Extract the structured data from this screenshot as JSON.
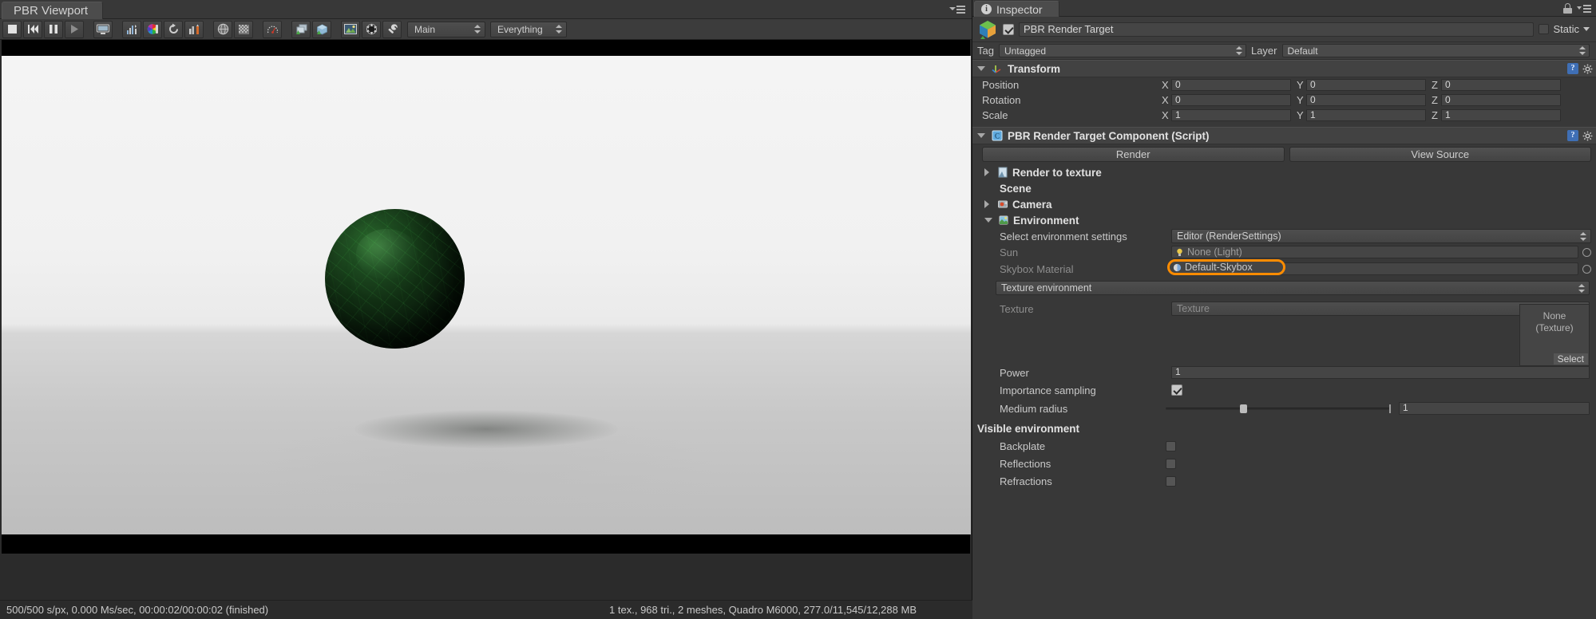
{
  "viewport": {
    "tab_label": "PBR Viewport",
    "toolbar": {
      "buttons": [
        {
          "name": "stop-button",
          "icon": "stop-icon"
        },
        {
          "name": "rewind-button",
          "icon": "rewind-icon"
        },
        {
          "name": "pause-button",
          "icon": "pause-icon"
        },
        {
          "name": "play-button",
          "icon": "play-icon"
        },
        {
          "name": "screen-button",
          "icon": "monitor-icon"
        },
        {
          "name": "histogram-button",
          "icon": "histogram-icon"
        },
        {
          "name": "color-wheel-button",
          "icon": "color-wheel-icon"
        },
        {
          "name": "refresh-button",
          "icon": "refresh-icon"
        },
        {
          "name": "levels-button",
          "icon": "levels-icon"
        },
        {
          "name": "sphere-button",
          "icon": "sphere-icon"
        },
        {
          "name": "checker-button",
          "icon": "checker-icon"
        },
        {
          "name": "gauge-button",
          "icon": "gauge-icon"
        },
        {
          "name": "layers-button",
          "icon": "layers-icon"
        },
        {
          "name": "cube-button",
          "icon": "cube-icon"
        },
        {
          "name": "image-button",
          "icon": "image-icon"
        },
        {
          "name": "aperture-button",
          "icon": "aperture-icon"
        },
        {
          "name": "wrench-button",
          "icon": "wrench-icon"
        }
      ],
      "camera_select": "Main",
      "layer_select": "Everything"
    },
    "status": {
      "left": "500/500 s/px, 0.000 Ms/sec, 00:00:02/00:00:02 (finished)",
      "right": "1 tex., 968 tri., 2 meshes, Quadro M6000, 277.0/11,545/12,288 MB"
    }
  },
  "inspector": {
    "tab_label": "Inspector",
    "object": {
      "name_value": "PBR Render Target",
      "enabled": true,
      "static_label": "Static",
      "tag_label": "Tag",
      "tag_value": "Untagged",
      "layer_label": "Layer",
      "layer_value": "Default"
    },
    "transform": {
      "title": "Transform",
      "rows": [
        {
          "label": "Position",
          "x": "0",
          "y": "0",
          "z": "0"
        },
        {
          "label": "Rotation",
          "x": "0",
          "y": "0",
          "z": "0"
        },
        {
          "label": "Scale",
          "x": "1",
          "y": "1",
          "z": "1"
        }
      ],
      "axis_x": "X",
      "axis_y": "Y",
      "axis_z": "Z"
    },
    "component": {
      "title": "PBR Render Target Component (Script)",
      "render_button": "Render",
      "view_source_button": "View Source",
      "render_to_texture": "Render to texture",
      "scene_label": "Scene",
      "camera_label": "Camera",
      "environment_label": "Environment",
      "select_env_label": "Select environment settings",
      "select_env_value": "Editor (RenderSettings)",
      "sun_label": "Sun",
      "sun_value": "None (Light)",
      "skybox_label": "Skybox Material",
      "skybox_value": "Default-Skybox",
      "texture_environment": "Texture environment",
      "texture_label": "Texture",
      "texture_value": "Texture",
      "texture_preview_line1": "None",
      "texture_preview_line2": "(Texture)",
      "texture_select": "Select",
      "power_label": "Power",
      "power_value": "1",
      "importance_label": "Importance sampling",
      "importance_checked": true,
      "medium_radius_label": "Medium radius",
      "medium_radius_value": "1",
      "medium_radius_percent": 33,
      "visible_env_title": "Visible environment",
      "backplate_label": "Backplate",
      "reflections_label": "Reflections",
      "refractions_label": "Refractions"
    }
  },
  "colors": {
    "highlight": "#ff8c00",
    "panel_bg": "#383838",
    "header_bg": "#424242",
    "field_bg": "#454545",
    "text": "#c9c9c9"
  }
}
